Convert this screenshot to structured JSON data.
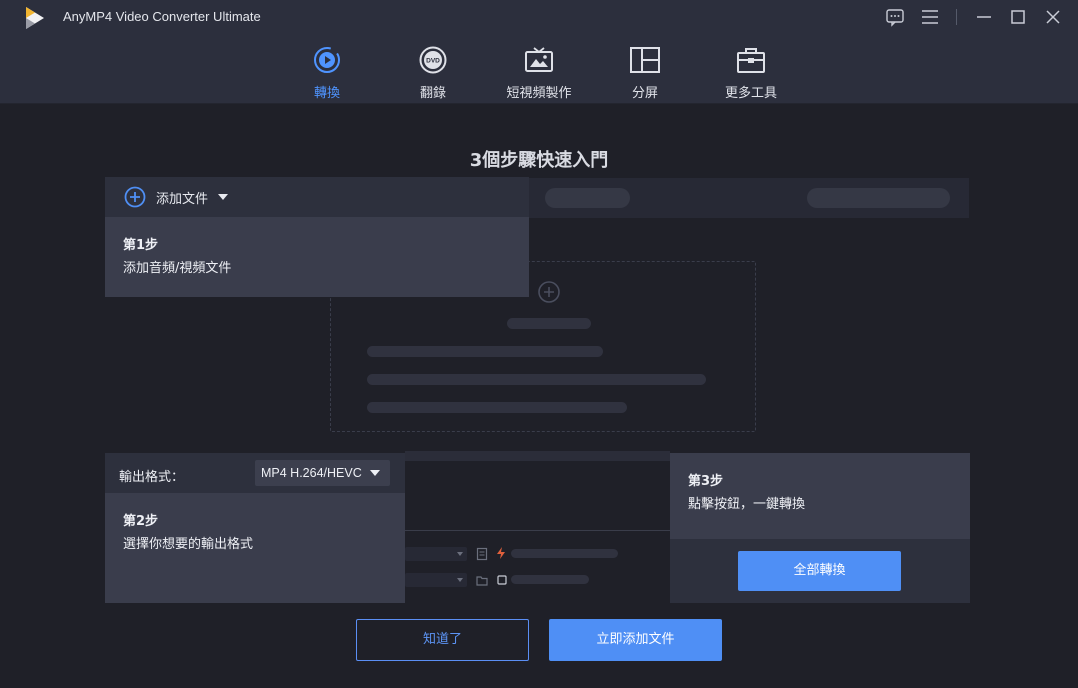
{
  "app": {
    "title": "AnyMP4 Video Converter Ultimate"
  },
  "nav": [
    {
      "label": "轉換",
      "icon": "convert-icon",
      "active": true
    },
    {
      "label": "翻錄",
      "icon": "dvd-icon",
      "active": false
    },
    {
      "label": "短視頻製作",
      "icon": "tv-icon",
      "active": false
    },
    {
      "label": "分屏",
      "icon": "split-screen-icon",
      "active": false
    },
    {
      "label": "更多工具",
      "icon": "toolbox-icon",
      "active": false
    }
  ],
  "guide": {
    "title": "3個步驟快速入門",
    "step1": {
      "action": "添加文件",
      "title": "第1步",
      "desc": "添加音頻/視頻文件"
    },
    "step2": {
      "format_label": "輸出格式：",
      "format_value": "MP4 H.264/HEVC",
      "title": "第2步",
      "desc": "選擇你想要的輸出格式"
    },
    "step3": {
      "title": "第3步",
      "desc": "點擊按鈕，一鍵轉換",
      "button": "全部轉換"
    },
    "got_it": "知道了",
    "add_now": "立即添加文件"
  },
  "colors": {
    "accent": "#4f8ff5",
    "titlebar": "#2c2f3d",
    "background": "#1f2028",
    "card": "#3a3d4c"
  }
}
